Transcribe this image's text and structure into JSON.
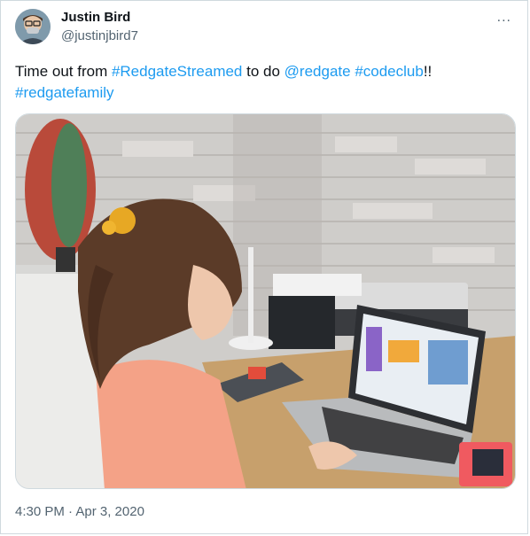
{
  "tweet": {
    "display_name": "Justin Bird",
    "handle": "@justinjbird7",
    "more_icon": "...",
    "text_parts": {
      "p1": "Time out from ",
      "h1": "#RedgateStreamed",
      "p2": " to do ",
      "m1": "@redgate",
      "p3": " ",
      "h2": "#codeclub",
      "p4": "!!",
      "h3": "#redgatefamily"
    },
    "timestamp": "4:30 PM · Apr 3, 2020"
  },
  "colors": {
    "link": "#1d9bf0",
    "secondary_text": "#536471",
    "primary_text": "#0f1419"
  },
  "photo": {
    "description_icon": "photo-icon"
  }
}
